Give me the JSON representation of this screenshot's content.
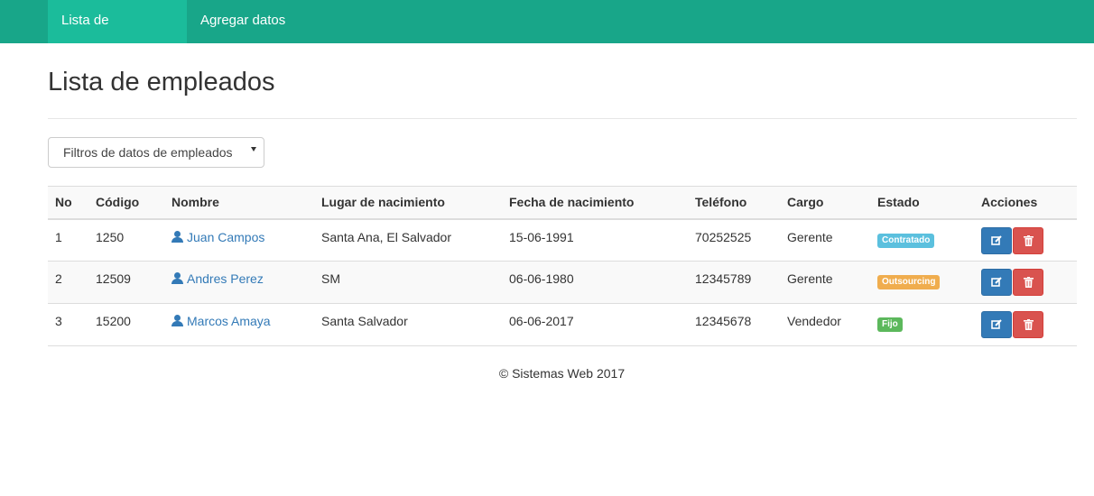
{
  "nav": {
    "tabs": [
      {
        "label": "Lista de empleados",
        "active": true
      },
      {
        "label": "Agregar datos",
        "active": false
      }
    ]
  },
  "page": {
    "title": "Lista de empleados",
    "filter_label": "Filtros de datos de empleados"
  },
  "table": {
    "headers": [
      "No",
      "Código",
      "Nombre",
      "Lugar de nacimiento",
      "Fecha de nacimiento",
      "Teléfono",
      "Cargo",
      "Estado",
      "Acciones"
    ],
    "rows": [
      {
        "no": "1",
        "codigo": "1250",
        "nombre": "Juan Campos",
        "lugar": "Santa Ana, El Salvador",
        "fecha": "15-06-1991",
        "telefono": "70252525",
        "cargo": "Gerente",
        "estado": "Contratado",
        "estado_color": "#5bc0de"
      },
      {
        "no": "2",
        "codigo": "12509",
        "nombre": "Andres Perez",
        "lugar": "SM",
        "fecha": "06-06-1980",
        "telefono": "12345789",
        "cargo": "Gerente",
        "estado": "Outsourcing",
        "estado_color": "#f0ad4e"
      },
      {
        "no": "3",
        "codigo": "15200",
        "nombre": "Marcos Amaya",
        "lugar": "Santa Salvador",
        "fecha": "06-06-2017",
        "telefono": "12345678",
        "cargo": "Vendedor",
        "estado": "Fijo",
        "estado_color": "#5cb85c"
      }
    ],
    "actions": {
      "edit_icon": "edit-icon",
      "delete_icon": "trash-icon"
    }
  },
  "footer": {
    "text": "© Sistemas Web 2017"
  },
  "colors": {
    "navbar": "#18a689",
    "nav_active": "#1bbc9b",
    "link": "#337ab7",
    "edit_button": "#337ab7",
    "delete_button": "#d9534f"
  }
}
